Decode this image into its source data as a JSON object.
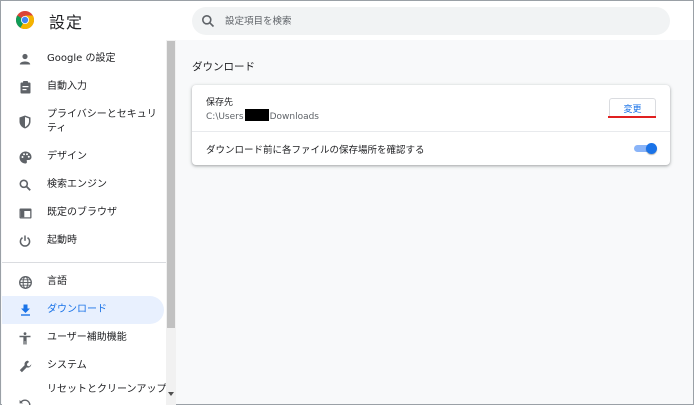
{
  "header": {
    "title": "設定",
    "search_placeholder": "設定項目を検索"
  },
  "sidebar": {
    "items": [
      {
        "label": "Google の設定",
        "icon": "person-icon"
      },
      {
        "label": "自動入力",
        "icon": "clipboard-icon"
      },
      {
        "label": "プライバシーとセキュリティ",
        "icon": "shield-icon"
      },
      {
        "label": "デザイン",
        "icon": "palette-icon"
      },
      {
        "label": "検索エンジン",
        "icon": "search-icon"
      },
      {
        "label": "既定のブラウザ",
        "icon": "browser-icon"
      },
      {
        "label": "起動時",
        "icon": "power-icon"
      },
      {
        "label": "言語",
        "icon": "globe-icon"
      },
      {
        "label": "ダウンロード",
        "icon": "download-icon",
        "active": true
      },
      {
        "label": "ユーザー補助機能",
        "icon": "accessibility-icon"
      },
      {
        "label": "システム",
        "icon": "wrench-icon"
      },
      {
        "label": "リセットとクリーンアップ",
        "icon": "reset-icon"
      }
    ]
  },
  "main": {
    "section_title": "ダウンロード",
    "save_location": {
      "label": "保存先",
      "path_prefix": "C:\\Users",
      "path_suffix": "Downloads",
      "change_label": "変更"
    },
    "ask_where_to_save": {
      "label": "ダウンロード前に各ファイルの保存場所を確認する",
      "enabled": true
    }
  },
  "colors": {
    "accent": "#1a73e8",
    "active_bg": "#e8f0fe",
    "highlight_underline": "#e02020"
  }
}
